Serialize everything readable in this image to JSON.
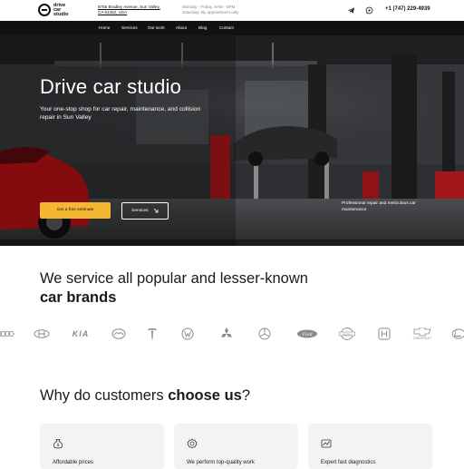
{
  "header": {
    "logo_text_1": "drive",
    "logo_text_2": "car",
    "logo_text_3": "studio",
    "address_line_1": "8765 Bradley Avenue, Sun Valley,",
    "address_line_2": "CA 91352, USA",
    "hours_line_1": "Monday - Friday, 9AM - 6PM",
    "hours_line_2": "Saturday: By appointment only",
    "phone": "+1 (747) 229-4939",
    "icons": [
      "telegram-icon",
      "whatsapp-icon"
    ]
  },
  "nav": {
    "items": [
      "Home",
      "Services",
      "Our work",
      "About",
      "Blog",
      "Contact"
    ]
  },
  "hero": {
    "title": "Drive car studio",
    "subtitle": "Your one-stop shop for car repair, maintenance, and collision repair in Sun Valley",
    "estimate_label": "Get a free estimate",
    "services_label": "Services",
    "note": "Professional repair and meticulous car maintenance",
    "accent_color": "#f5b731"
  },
  "brands": {
    "title_part_1": "We service all popular and lesser-known ",
    "title_bold": "car brands",
    "logos": [
      "audi-logo",
      "hyundai-logo",
      "kia-logo",
      "mazda-logo",
      "tesla-logo",
      "volkswagen-logo",
      "mitsubishi-logo",
      "mercedes-logo",
      "ford-logo",
      "nissan-logo",
      "honda-logo",
      "chevrolet-logo",
      "lexus-logo"
    ],
    "kia_text": "KIA",
    "ford_text": "Ford",
    "nissan_text": "NISSAN",
    "chevrolet_text": "CHEVROLET"
  },
  "why": {
    "title_part_1": "Why do customers ",
    "title_bold": "choose us",
    "title_end": "?",
    "cards": [
      {
        "icon": "money-bag-icon",
        "text": "Affordable prices"
      },
      {
        "icon": "warranty-icon",
        "text": "We perform top-quality work"
      },
      {
        "icon": "diagnostics-icon",
        "text": "Expert fast diagnostics"
      }
    ]
  }
}
